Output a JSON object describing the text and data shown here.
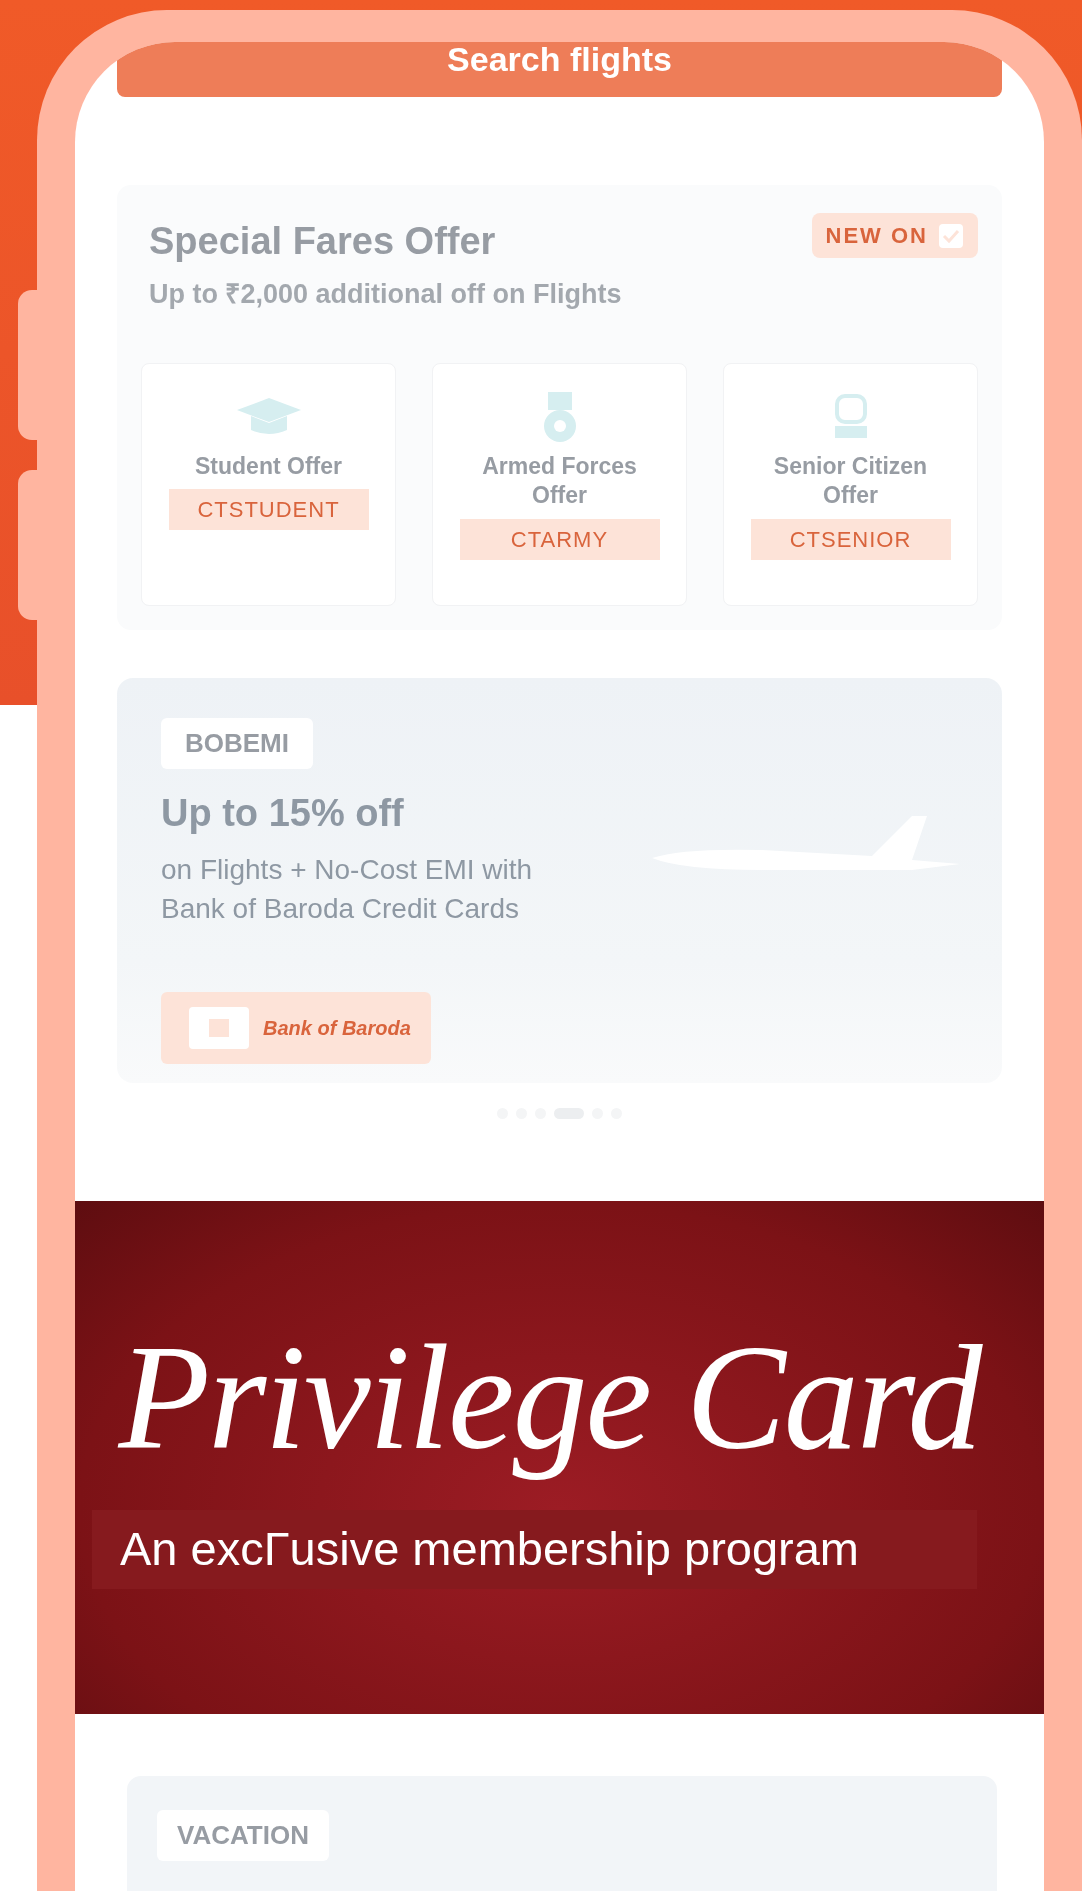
{
  "search_button": {
    "label": "Search flights"
  },
  "special_fares": {
    "title": "Special Fares Offer",
    "badge": "NEW ON",
    "subtitle": "Up to ₹2,000 additional off on Flights",
    "offers": [
      {
        "kind": "student",
        "label": "Student Offer",
        "code": "CTSTUDENT"
      },
      {
        "kind": "army",
        "label": "Armed Forces Offer",
        "code": "CTARMY"
      },
      {
        "kind": "senior",
        "label": "Senior Citizen Offer",
        "code": "CTSENIOR"
      }
    ]
  },
  "promo_banner": {
    "code": "BOBEMI",
    "headline": "Up to 15% off",
    "text": "on Flights + No-Cost EMI with Bank of Baroda Credit Cards",
    "bank_logo": "Bank of Baroda"
  },
  "carousel_dots": [
    {
      "selected": false
    },
    {
      "selected": false
    },
    {
      "selected": false
    },
    {
      "selected": true
    },
    {
      "selected": false
    },
    {
      "selected": false
    }
  ],
  "privilege_banner": {
    "title": "Privilege Card",
    "caption": "An excΓusive membership program"
  },
  "next_banner": {
    "code": "VACATION"
  }
}
